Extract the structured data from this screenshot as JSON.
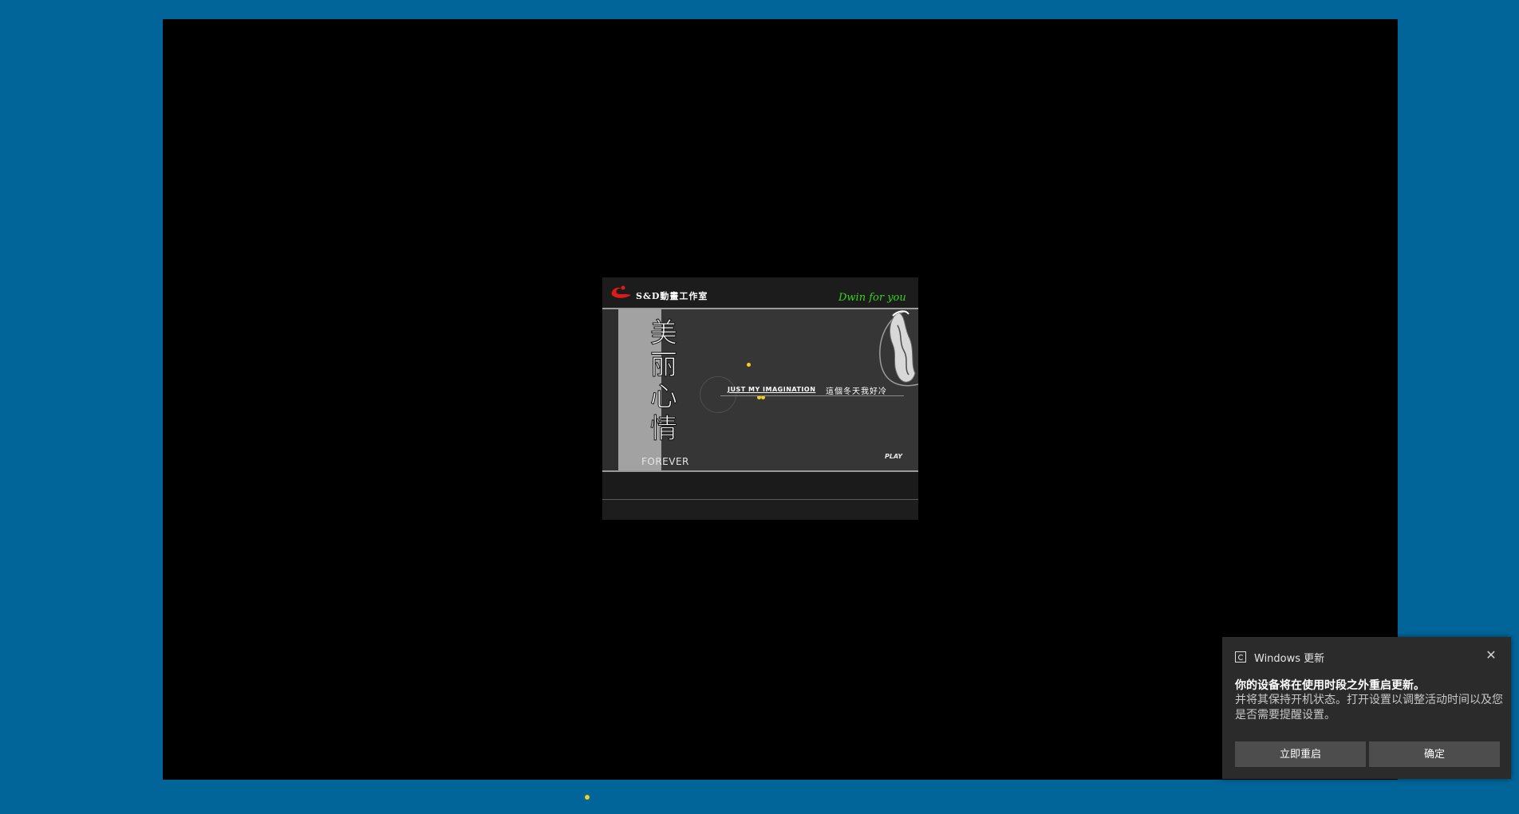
{
  "flash": {
    "studio_name": "S&D動畫工作室",
    "signature": "Dwin for you",
    "title_chars": [
      "美",
      "丽",
      "心",
      "情"
    ],
    "forever": "FOREVER",
    "tagline_en": "JUST MY IMAGINATION",
    "tagline_cn": "這個冬天我好冷",
    "play": "PLAY"
  },
  "toast": {
    "app_name": "Windows 更新",
    "close_icon": "close-icon",
    "title": "你的设备将在使用时段之外重启更新。",
    "body": "并将其保持开机状态。打开设置以调整活动时间以及您是否需要提醒设置。",
    "restart_label": "立即重启",
    "ok_label": "确定"
  },
  "colors": {
    "desktop": "#01659a",
    "signature": "#3bd11f",
    "accent_dot": "#f2cf1d",
    "toast_bg": "#2b2b2b",
    "toast_button": "#4d4d4d"
  }
}
